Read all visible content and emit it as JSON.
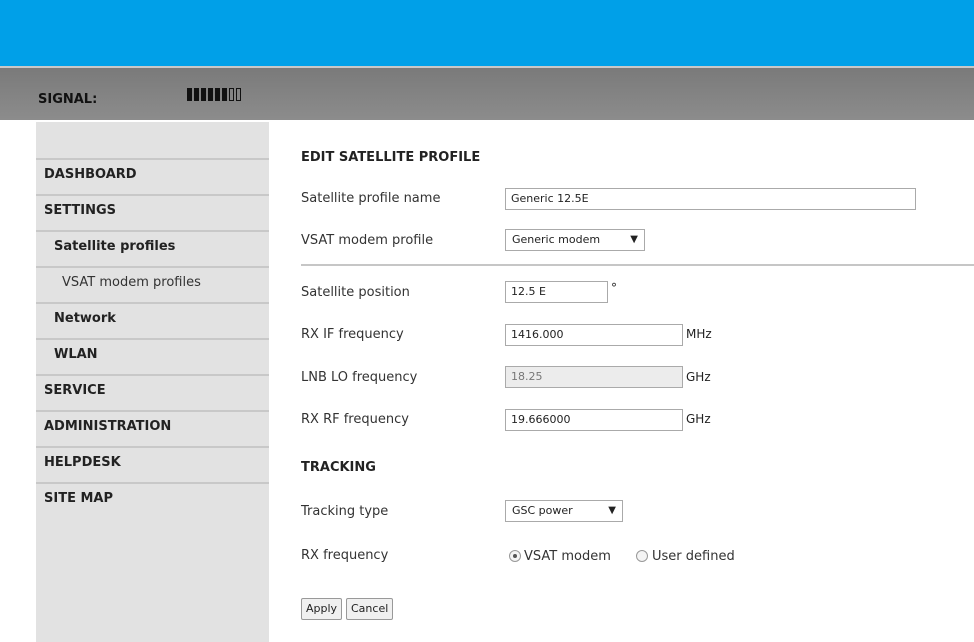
{
  "status": {
    "signal_label": "SIGNAL:",
    "signal_bars_filled": 6,
    "signal_bars_total": 8
  },
  "sidebar": {
    "items": [
      {
        "label": "DASHBOARD"
      },
      {
        "label": "SETTINGS"
      },
      {
        "label": "Satellite profiles"
      },
      {
        "label": "VSAT modem profiles"
      },
      {
        "label": "Network"
      },
      {
        "label": "WLAN"
      },
      {
        "label": "SERVICE"
      },
      {
        "label": "ADMINISTRATION"
      },
      {
        "label": "HELPDESK"
      },
      {
        "label": "SITE MAP"
      }
    ]
  },
  "form": {
    "title": "EDIT SATELLITE PROFILE",
    "profile_name_label": "Satellite profile name",
    "profile_name_value": "Generic 12.5E",
    "modem_profile_label": "VSAT modem profile",
    "modem_profile_value": "Generic modem",
    "position_label": "Satellite position",
    "position_value": "12.5 E",
    "position_unit": "°",
    "rx_if_label": "RX IF frequency",
    "rx_if_value": "1416.000",
    "rx_if_unit": "MHz",
    "lnb_lo_label": "LNB LO frequency",
    "lnb_lo_value": "18.25",
    "lnb_lo_unit": "GHz",
    "rx_rf_label": "RX RF frequency",
    "rx_rf_value": "19.666000",
    "rx_rf_unit": "GHz"
  },
  "tracking": {
    "title": "TRACKING",
    "type_label": "Tracking type",
    "type_value": "GSC power",
    "rx_freq_label": "RX frequency",
    "option_vsat": "VSAT modem",
    "option_user": "User defined",
    "selected_option": "VSAT modem"
  },
  "buttons": {
    "apply": "Apply",
    "cancel": "Cancel"
  },
  "colors": {
    "top_bar": "#00a0e8",
    "status_bar": "#858585",
    "sidebar_bg": "#e2e2e2"
  },
  "icons": {
    "dropdown": "triangle-down-icon"
  }
}
